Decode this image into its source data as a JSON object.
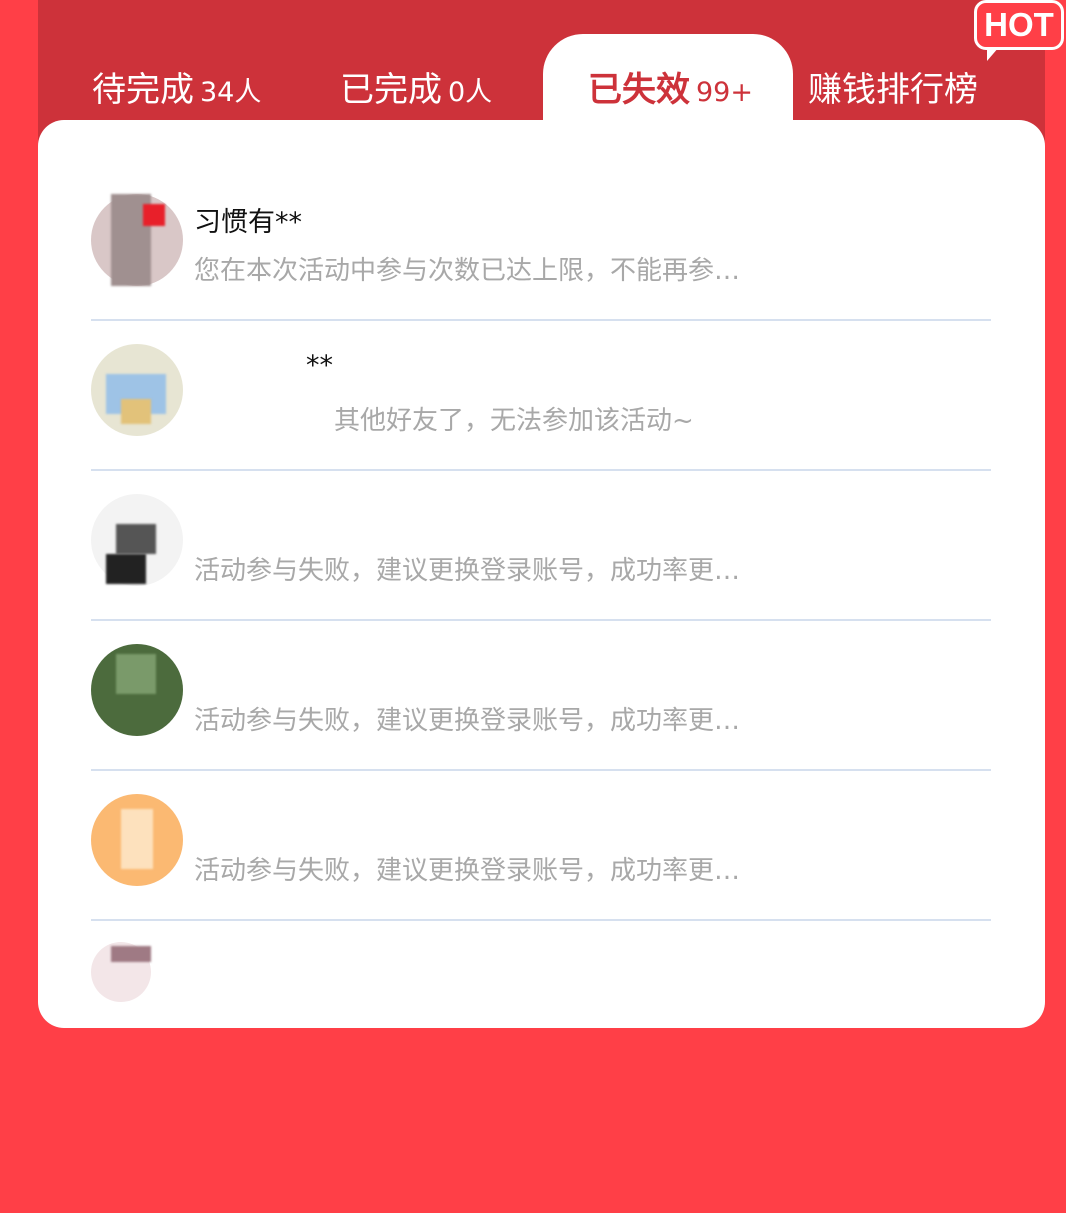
{
  "tabs": [
    {
      "label": "待完成",
      "count": "34人"
    },
    {
      "label": "已完成",
      "count": "0人"
    },
    {
      "label": "已失效",
      "count": "99+"
    },
    {
      "label": "赚钱排行榜",
      "count": ""
    }
  ],
  "badge": {
    "text": "HOT"
  },
  "colors": {
    "background": "#ff3f47",
    "panel": "#cd323a",
    "card": "#ffffff",
    "text_muted": "#a8a8a8"
  },
  "list": [
    {
      "name": "习惯有**",
      "message": "您在本次活动中参与次数已达上限，不能再参…"
    },
    {
      "name": "**",
      "message": "其他好友了，无法参加该活动~"
    },
    {
      "name": "",
      "message": "活动参与失败，建议更换登录账号，成功率更…"
    },
    {
      "name": "",
      "message": "活动参与失败，建议更换登录账号，成功率更…"
    },
    {
      "name": "",
      "message": "活动参与失败，建议更换登录账号，成功率更…"
    }
  ]
}
